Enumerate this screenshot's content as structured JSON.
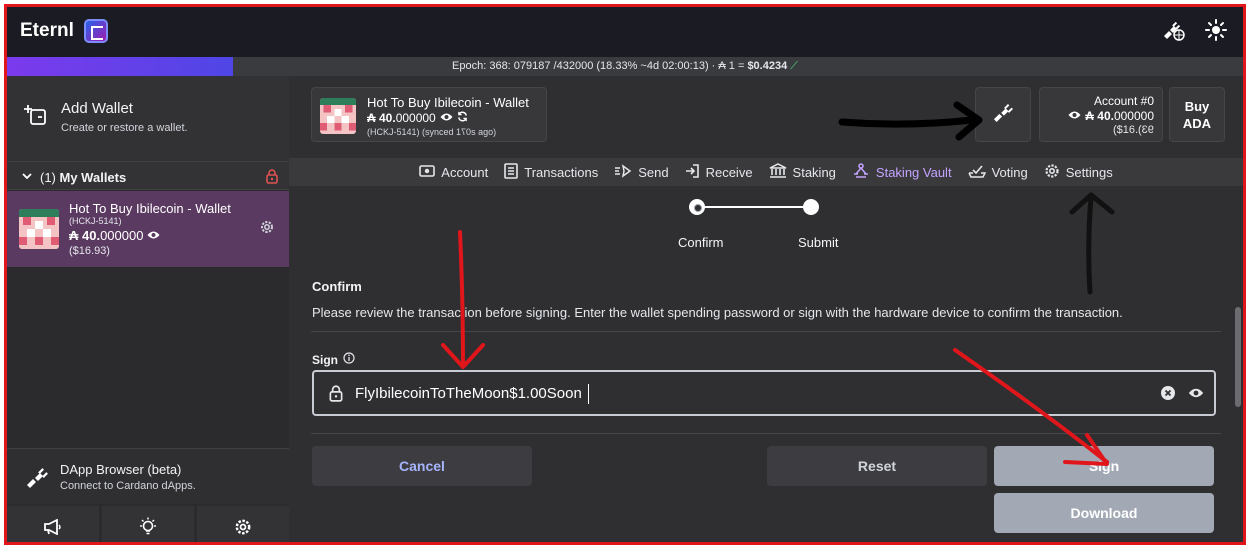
{
  "app": {
    "name": "Eternl",
    "brand_color": "#7c3aed"
  },
  "epoch": {
    "text": "Epoch: 368: 079187 /432000 (18.33% ~4d 02:00:13) · ₳ 1 = ",
    "price": "$0.4234",
    "progress": 0.1833
  },
  "sidebar": {
    "add_wallet_title": "Add Wallet",
    "add_wallet_sub": "Create or restore a wallet.",
    "my_wallets_count": "(1)",
    "my_wallets_label": "My Wallets",
    "wallet": {
      "name": "Hot To Buy Ibilecoin - Wallet",
      "id": "(HCKJ-5141)",
      "balance_int": "₳ 40.",
      "balance_dec": "000000",
      "usd": "($16.93)"
    },
    "dapp_title": "DApp Browser (beta)",
    "dapp_sub": "Connect to Cardano dApps."
  },
  "header": {
    "wallet_name": "Hot To Buy Ibilecoin - Wallet",
    "balance_int": "₳ 40.",
    "balance_dec": "000000",
    "sync_status": "(HCKJ-5141) (synced 1",
    "sync_mirror": "07",
    "sync_tail": "s ago)",
    "account_label": "Account #0",
    "account_balance_int": "₳ 40.",
    "account_balance_dec": "000000",
    "account_usd_a": "($16.",
    "account_usd_b": "93)",
    "buy_label_1": "Buy",
    "buy_label_2": "ADA"
  },
  "tabs": [
    {
      "label": "Account",
      "icon": "account-icon"
    },
    {
      "label": "Transactions",
      "icon": "transactions-icon"
    },
    {
      "label": "Send",
      "icon": "send-icon"
    },
    {
      "label": "Receive",
      "icon": "receive-icon"
    },
    {
      "label": "Staking",
      "icon": "staking-icon"
    },
    {
      "label": "Staking Vault",
      "icon": "vault-icon",
      "active": true
    },
    {
      "label": "Voting",
      "icon": "voting-icon"
    },
    {
      "label": "Settings",
      "icon": "settings-icon"
    }
  ],
  "stepper": {
    "step1": "Confirm",
    "step2": "Submit"
  },
  "confirm": {
    "heading": "Confirm",
    "description": "Please review the transaction before signing. Enter the wallet spending password or sign with the hardware device to confirm the transaction."
  },
  "sign": {
    "label": "Sign",
    "value": "FlyIbilecoinToTheMoon$1.00Soon"
  },
  "buttons": {
    "cancel": "Cancel",
    "reset": "Reset",
    "sign": "Sign",
    "download": "Download"
  },
  "colors": {
    "annotation_red": "#e0161b",
    "active_tab": "#c4a3ff",
    "selected_wallet_bg": "#5b3a62"
  }
}
